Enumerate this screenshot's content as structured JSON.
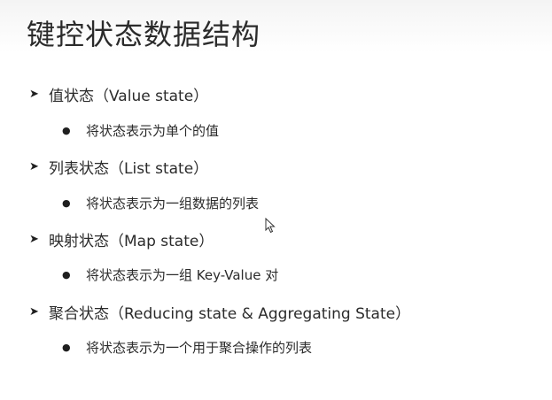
{
  "title": "键控状态数据结构",
  "items": [
    {
      "label": "值状态（Value state）",
      "sub": "将状态表示为单个的值"
    },
    {
      "label": "列表状态（List state）",
      "sub": "将状态表示为一组数据的列表"
    },
    {
      "label": "映射状态（Map state）",
      "sub": "将状态表示为一组 Key-Value 对"
    },
    {
      "label": "聚合状态（Reducing state & Aggregating State）",
      "sub": "将状态表示为一个用于聚合操作的列表"
    }
  ],
  "icons": {
    "bullet_level1": "arrow-bullet-icon",
    "bullet_level2": "dot-bullet-icon",
    "cursor": "mouse-pointer-icon"
  }
}
